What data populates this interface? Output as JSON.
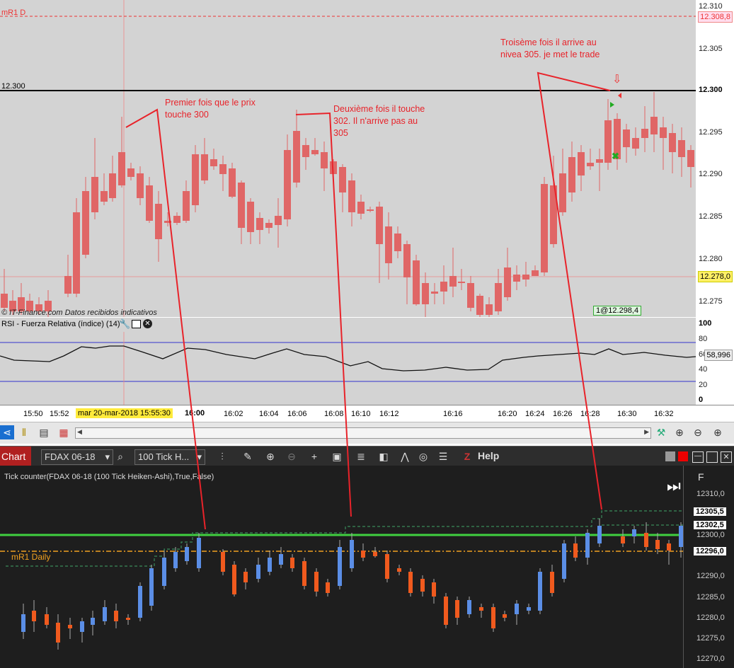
{
  "top_chart": {
    "level_label_left": "12.300",
    "mr1_label": "mR1 D",
    "source_text": "© IT-Finance.com Datos recibidos indicativos",
    "position_badge": "1@12.298,4",
    "price_axis": [
      "12.310",
      "12.305",
      "12.300",
      "12.295",
      "12.290",
      "12.285",
      "12.280",
      "12.275"
    ],
    "tag_mr1": "12.308,8",
    "tag_cursor": "12.278,0",
    "colors": {
      "bg": "#d3d3d3",
      "up": "#3d8fe8",
      "down": "#e06666",
      "annotation": "#e8232a"
    }
  },
  "annotations": {
    "first": "Premier fois que le prix touche 300",
    "second": "Deuxième fois il touche 302. Il n'arrive pas au 305",
    "third": "Troisème fois il arrive au nivea 305. je met le trade"
  },
  "rsi": {
    "header": "RSI - Fuerza Relativa (índice) (14)",
    "axis": [
      "100",
      "80",
      "60",
      "40",
      "20",
      "0"
    ],
    "value_tag": "58,996"
  },
  "time_axis": {
    "labels": [
      "15:50",
      "15:52",
      "16:00",
      "16:02",
      "16:04",
      "16:06",
      "16:08",
      "16:10",
      "16:12",
      "16:16",
      "16:20",
      "16:24",
      "16:26",
      "16:28",
      "16:30",
      "16:32"
    ],
    "cursor_label": "mar 20-mar-2018 15:55:30"
  },
  "bottom_toolbar": {
    "chart_label": "Chart",
    "instrument": "FDAX 06-18",
    "bar_type": "100 Tick H...",
    "help": "Help"
  },
  "bottom_chart": {
    "indicator_label": "Tick counter(FDAX 06-18 (100 Tick Heiken-Ashi),True,False)",
    "mr1_daily": "mR1 Daily",
    "f_label": "F",
    "price_axis": [
      "12310,0",
      "12300,0",
      "12290,0",
      "12285,0",
      "12280,0",
      "12275,0",
      "12270,0"
    ],
    "tags": [
      "12305,5",
      "12302,5",
      "12296,0"
    ],
    "colors": {
      "bg": "#1e1e1e",
      "up": "#5b8ee6",
      "down": "#f05a1e",
      "green_line": "#40d040",
      "orange_line": "#f0a020"
    }
  }
}
